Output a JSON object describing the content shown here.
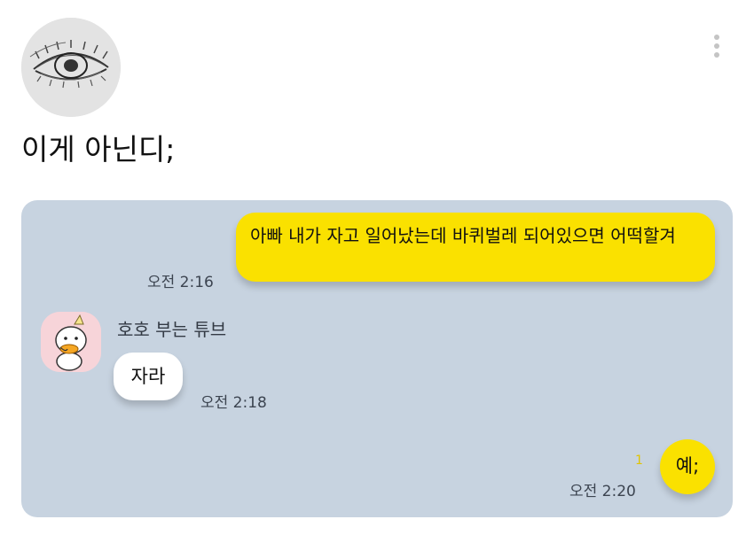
{
  "post": {
    "text": "이게 아닌디;"
  },
  "icons": {
    "profile": "eye-sketch-avatar",
    "more": "vertical-dots-icon",
    "friend": "duck-character-avatar"
  },
  "colors": {
    "chat_background": "#c7d3e0",
    "sent_bubble": "#fae100",
    "received_bubble": "#ffffff"
  },
  "chat": {
    "messages": [
      {
        "side": "sent",
        "text": "아빠 내가 자고 일어났는데 바퀴벌레 되어있으면 어떡할겨",
        "time": "오전 2:16"
      },
      {
        "side": "received",
        "sender": "호호 부는 튜브",
        "text": "자라",
        "time": "오전 2:18"
      },
      {
        "side": "sent",
        "text": "예;",
        "time": "오전 2:20",
        "unread": "1"
      }
    ]
  }
}
